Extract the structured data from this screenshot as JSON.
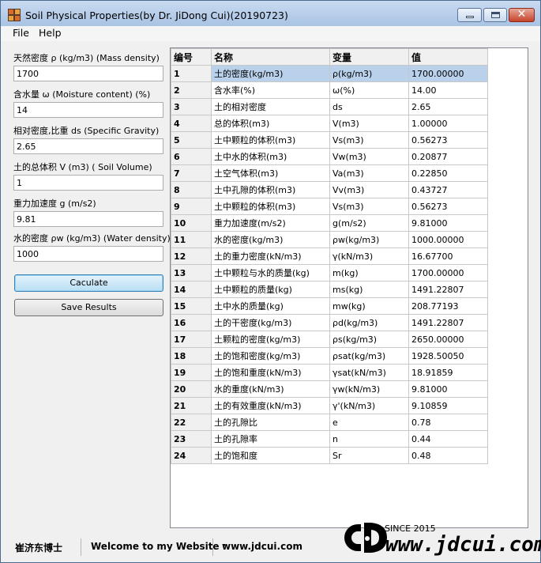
{
  "window": {
    "title": "Soil Physical Properties(by Dr. JiDong Cui)(20190723)",
    "close_glyph": "✕"
  },
  "menu": [
    "File",
    "Help"
  ],
  "inputs": [
    {
      "label": "天然密度 ρ (kg/m3) (Mass density)",
      "value": "1700"
    },
    {
      "label": "含水量 ω (Moisture content) (%)",
      "value": "14"
    },
    {
      "label": "相对密度,比重 ds (Specific Gravity)",
      "value": "2.65"
    },
    {
      "label": "土的总体积 V (m3) ( Soil Volume)",
      "value": "1"
    },
    {
      "label": "重力加速度 g  (m/s2)",
      "value": "9.81"
    },
    {
      "label": "水的密度 ρw (kg/m3) (Water density)",
      "value": "1000"
    }
  ],
  "buttons": {
    "calculate": "Caculate",
    "save": "Save Results"
  },
  "table": {
    "headers": [
      "编号",
      "名称",
      "变量",
      "值"
    ],
    "selected_row": 0,
    "rows": [
      [
        "1",
        "土的密度(kg/m3)",
        "ρ(kg/m3)",
        "1700.00000"
      ],
      [
        "2",
        "含水率(%)",
        "ω(%)",
        "14.00"
      ],
      [
        "3",
        "土的相对密度",
        "ds",
        "2.65"
      ],
      [
        "4",
        "总的体积(m3)",
        "V(m3)",
        "1.00000"
      ],
      [
        "5",
        "土中颗粒的体积(m3)",
        "Vs(m3)",
        "0.56273"
      ],
      [
        "6",
        "土中水的体积(m3)",
        "Vw(m3)",
        "0.20877"
      ],
      [
        "7",
        "土空气体积(m3)",
        "Va(m3)",
        "0.22850"
      ],
      [
        "8",
        "土中孔隙的体积(m3)",
        "Vv(m3)",
        "0.43727"
      ],
      [
        "9",
        "土中颗粒的体积(m3)",
        "Vs(m3)",
        "0.56273"
      ],
      [
        "10",
        "重力加速度(m/s2)",
        "g(m/s2)",
        "9.81000"
      ],
      [
        "11",
        "水的密度(kg/m3)",
        "ρw(kg/m3)",
        "1000.00000"
      ],
      [
        "12",
        "土的重力密度(kN/m3)",
        "γ(kN/m3)",
        "16.67700"
      ],
      [
        "13",
        "土中颗粒与水的质量(kg)",
        "m(kg)",
        "1700.00000"
      ],
      [
        "14",
        "土中颗粒的质量(kg)",
        "ms(kg)",
        "1491.22807"
      ],
      [
        "15",
        "土中水的质量(kg)",
        "mw(kg)",
        "208.77193"
      ],
      [
        "16",
        "土的干密度(kg/m3)",
        "ρd(kg/m3)",
        "1491.22807"
      ],
      [
        "17",
        "土颗粒的密度(kg/m3)",
        "ρs(kg/m3)",
        "2650.00000"
      ],
      [
        "18",
        "土的饱和密度(kg/m3)",
        "ρsat(kg/m3)",
        "1928.50050"
      ],
      [
        "19",
        "土的饱和重度(kN/m3)",
        "γsat(kN/m3)",
        "18.91859"
      ],
      [
        "20",
        "水的重度(kN/m3)",
        "γw(kN/m3)",
        "9.81000"
      ],
      [
        "21",
        "土的有效重度(kN/m3)",
        "γ'(kN/m3)",
        "9.10859"
      ],
      [
        "22",
        "土的孔隙比",
        "e",
        "0.78"
      ],
      [
        "23",
        "土的孔隙率",
        "n",
        "0.44"
      ],
      [
        "24",
        "土的饱和度",
        "Sr",
        "0.48"
      ]
    ]
  },
  "status": {
    "author": "崔济东博士",
    "welcome": "Welcome to my Website :",
    "url": "www.jdcui.com"
  },
  "logo": {
    "since": "SINCE 2015",
    "site": "www.jdcui.com"
  },
  "colors": {
    "selection": "#b9d1ea",
    "titlebar": "#a9c3e4",
    "close_button": "#c5432b"
  }
}
